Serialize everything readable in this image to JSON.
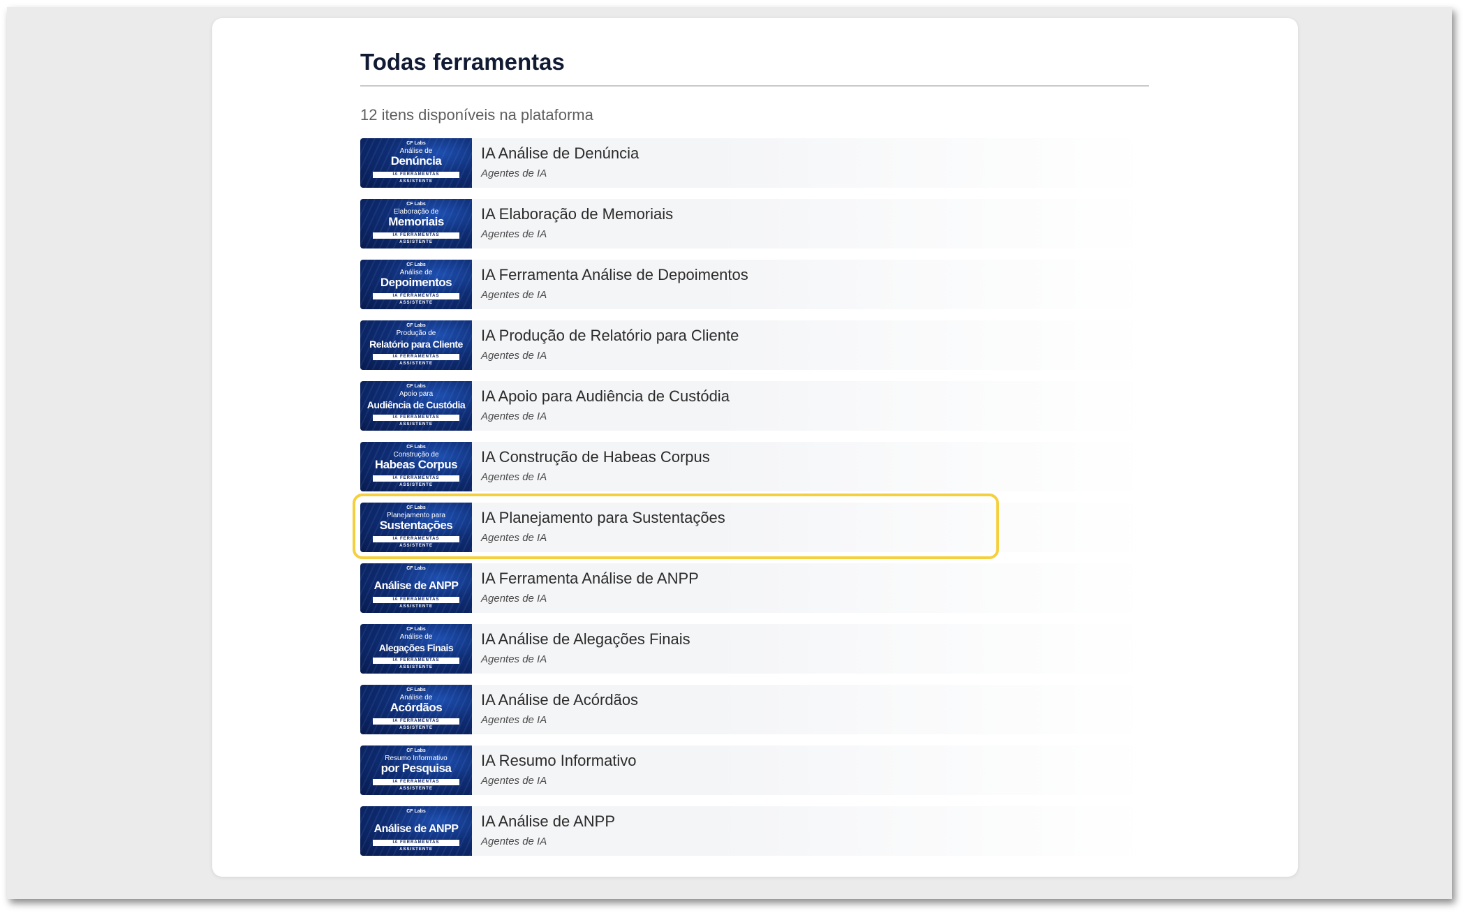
{
  "page": {
    "title": "Todas ferramentas",
    "subtitle": "12 itens disponíveis na plataforma"
  },
  "colors": {
    "highlight": "#f4d03f",
    "title": "#111a33",
    "thumbnail_blue": "#0f2d74"
  },
  "thumbnail_common": {
    "logo": "CF Labs",
    "band": "IA FERRAMENTAS",
    "band2": "ASSISTENTE"
  },
  "highlighted_index": 6,
  "tools": [
    {
      "name": "IA Análise de Denúncia",
      "category": "Agentes de IA",
      "thumb_line1": "Análise de",
      "thumb_line2": "Denúncia"
    },
    {
      "name": "IA Elaboração de Memoriais",
      "category": "Agentes de IA",
      "thumb_line1": "Elaboração de",
      "thumb_line2": "Memoriais"
    },
    {
      "name": "IA Ferramenta Análise de Depoimentos",
      "category": "Agentes de IA",
      "thumb_line1": "Análise de",
      "thumb_line2": "Depoimentos"
    },
    {
      "name": "IA Produção de Relatório para Cliente",
      "category": "Agentes de IA",
      "thumb_line1": "Produção de",
      "thumb_line2": "Relatório para Cliente"
    },
    {
      "name": "IA Apoio para Audiência de Custódia",
      "category": "Agentes de IA",
      "thumb_line1": "Apoio para",
      "thumb_line2": "Audiência de Custódia"
    },
    {
      "name": "IA Construção de Habeas Corpus",
      "category": "Agentes de IA",
      "thumb_line1": "Construção de",
      "thumb_line2": "Habeas Corpus"
    },
    {
      "name": "IA Planejamento para Sustentações",
      "category": "Agentes de IA",
      "thumb_line1": "Planejamento para",
      "thumb_line2": "Sustentações"
    },
    {
      "name": "IA Ferramenta Análise de ANPP",
      "category": "Agentes de IA",
      "thumb_line1": "",
      "thumb_line2": "Análise de ANPP"
    },
    {
      "name": "IA Análise de Alegações Finais",
      "category": "Agentes de IA",
      "thumb_line1": "Análise de",
      "thumb_line2": "Alegações Finais"
    },
    {
      "name": "IA Análise de Acórdãos",
      "category": "Agentes de IA",
      "thumb_line1": "Análise de",
      "thumb_line2": "Acórdãos"
    },
    {
      "name": "IA Resumo Informativo",
      "category": "Agentes de IA",
      "thumb_line1": "Resumo Informativo",
      "thumb_line2": "por Pesquisa"
    },
    {
      "name": "IA Análise de ANPP",
      "category": "Agentes de IA",
      "thumb_line1": "",
      "thumb_line2": "Análise de ANPP"
    }
  ]
}
